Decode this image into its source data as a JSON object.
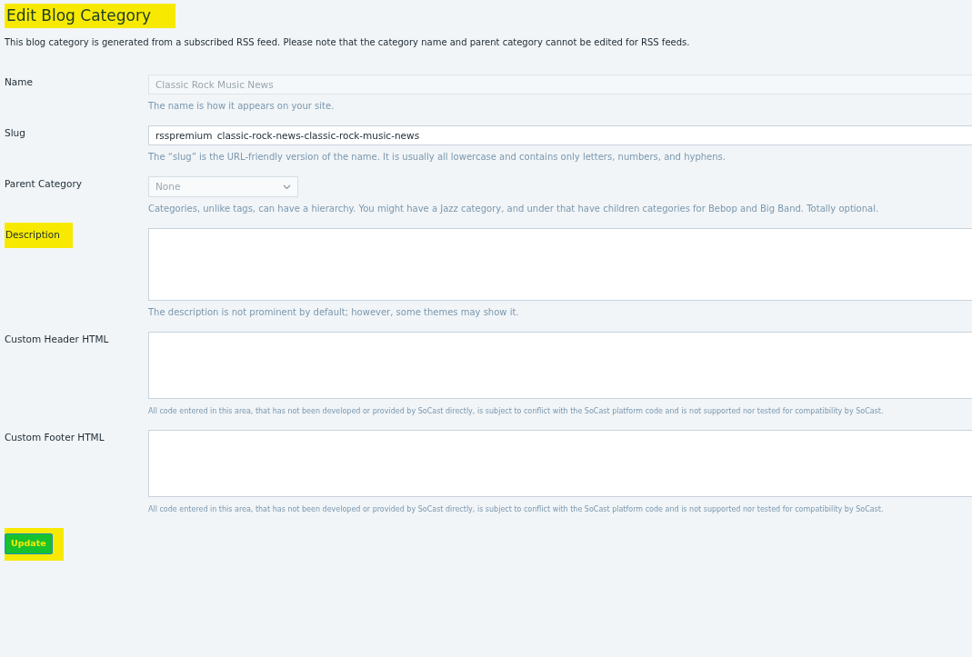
{
  "title": {
    "text": "Edit Blog Category",
    "highlighted": true
  },
  "notice": "This blog category is generated from a subscribed RSS feed. Please note that the category name and parent category cannot be edited for RSS feeds.",
  "fields": [
    {
      "kind": "text",
      "label": "Name",
      "highlighted": false,
      "value": "Classic Rock Music News",
      "disabled": true,
      "help": "The name is how it appears on your site.",
      "fine_print": false
    },
    {
      "kind": "text",
      "label": "Slug",
      "highlighted": false,
      "value": "rsspremium_classic-rock-news-classic-rock-music-news",
      "disabled": false,
      "help": "The “slug” is the URL-friendly version of the name. It is usually all lowercase and contains only letters, numbers, and hyphens.",
      "fine_print": false
    },
    {
      "kind": "select",
      "label": "Parent Category",
      "highlighted": false,
      "value": "None",
      "disabled": true,
      "help": "Categories, unlike tags, can have a hierarchy. You might have a Jazz category, and under that have children categories for Bebop and Big Band. Totally optional.",
      "fine_print": false
    },
    {
      "kind": "textarea",
      "label": "Description",
      "highlighted": true,
      "help": "The description is not prominent by default; however, some themes may show it.",
      "fine_print": false
    },
    {
      "kind": "textarea",
      "label": "Custom Header HTML",
      "highlighted": false,
      "help": "All code entered in this area, that has not been developed or provided by SoCast directly, is subject to conflict with the SoCast platform code and is not supported nor tested for compatibility by SoCast.",
      "fine_print": true
    },
    {
      "kind": "textarea",
      "label": "Custom Footer HTML",
      "highlighted": false,
      "help": "All code entered in this area, that has not been developed or provided by SoCast directly, is subject to conflict with the SoCast platform code and is not supported nor tested for compatibility by SoCast.",
      "fine_print": true
    }
  ],
  "submit": {
    "label": "Update",
    "highlighted": true
  }
}
